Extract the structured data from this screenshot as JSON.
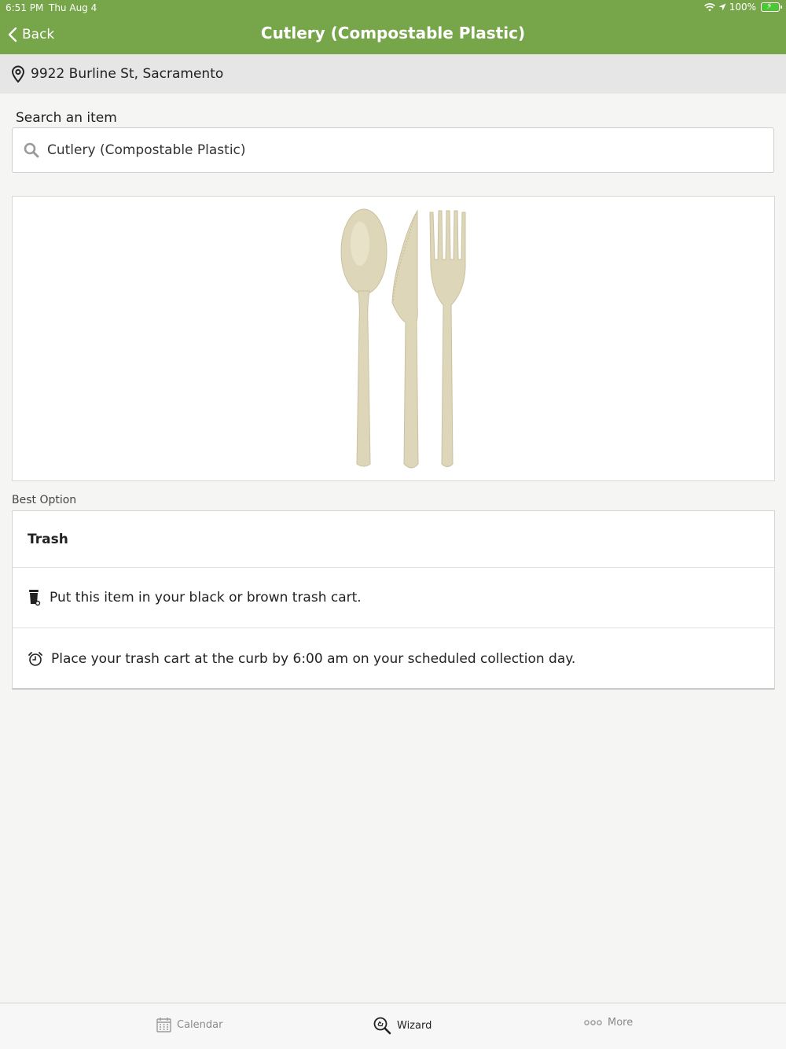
{
  "status_bar": {
    "time": "6:51 PM",
    "date": "Thu Aug 4",
    "battery": "100%"
  },
  "header": {
    "back_label": "Back",
    "title": "Cutlery (Compostable Plastic)"
  },
  "address": {
    "text": "9922 Burline St, Sacramento"
  },
  "search": {
    "label": "Search an item",
    "value": "Cutlery (Compostable Plastic)"
  },
  "best_option": {
    "section_label": "Best Option",
    "title": "Trash",
    "instructions": [
      {
        "icon": "trash-can-icon",
        "text": "Put this item in your black or brown trash cart."
      },
      {
        "icon": "alarm-clock-icon",
        "text": "Place your trash cart at the curb by 6:00 am on your scheduled collection day."
      }
    ]
  },
  "tabs": [
    {
      "label": "Calendar",
      "icon": "calendar-icon",
      "active": false
    },
    {
      "label": "Wizard",
      "icon": "recycle-search-icon",
      "active": true
    },
    {
      "label": "More",
      "icon": "more-dots-icon",
      "active": false
    }
  ],
  "colors": {
    "header": "#77a54a",
    "background": "#f5f6f4",
    "cutlery": "#ddd6b8"
  }
}
